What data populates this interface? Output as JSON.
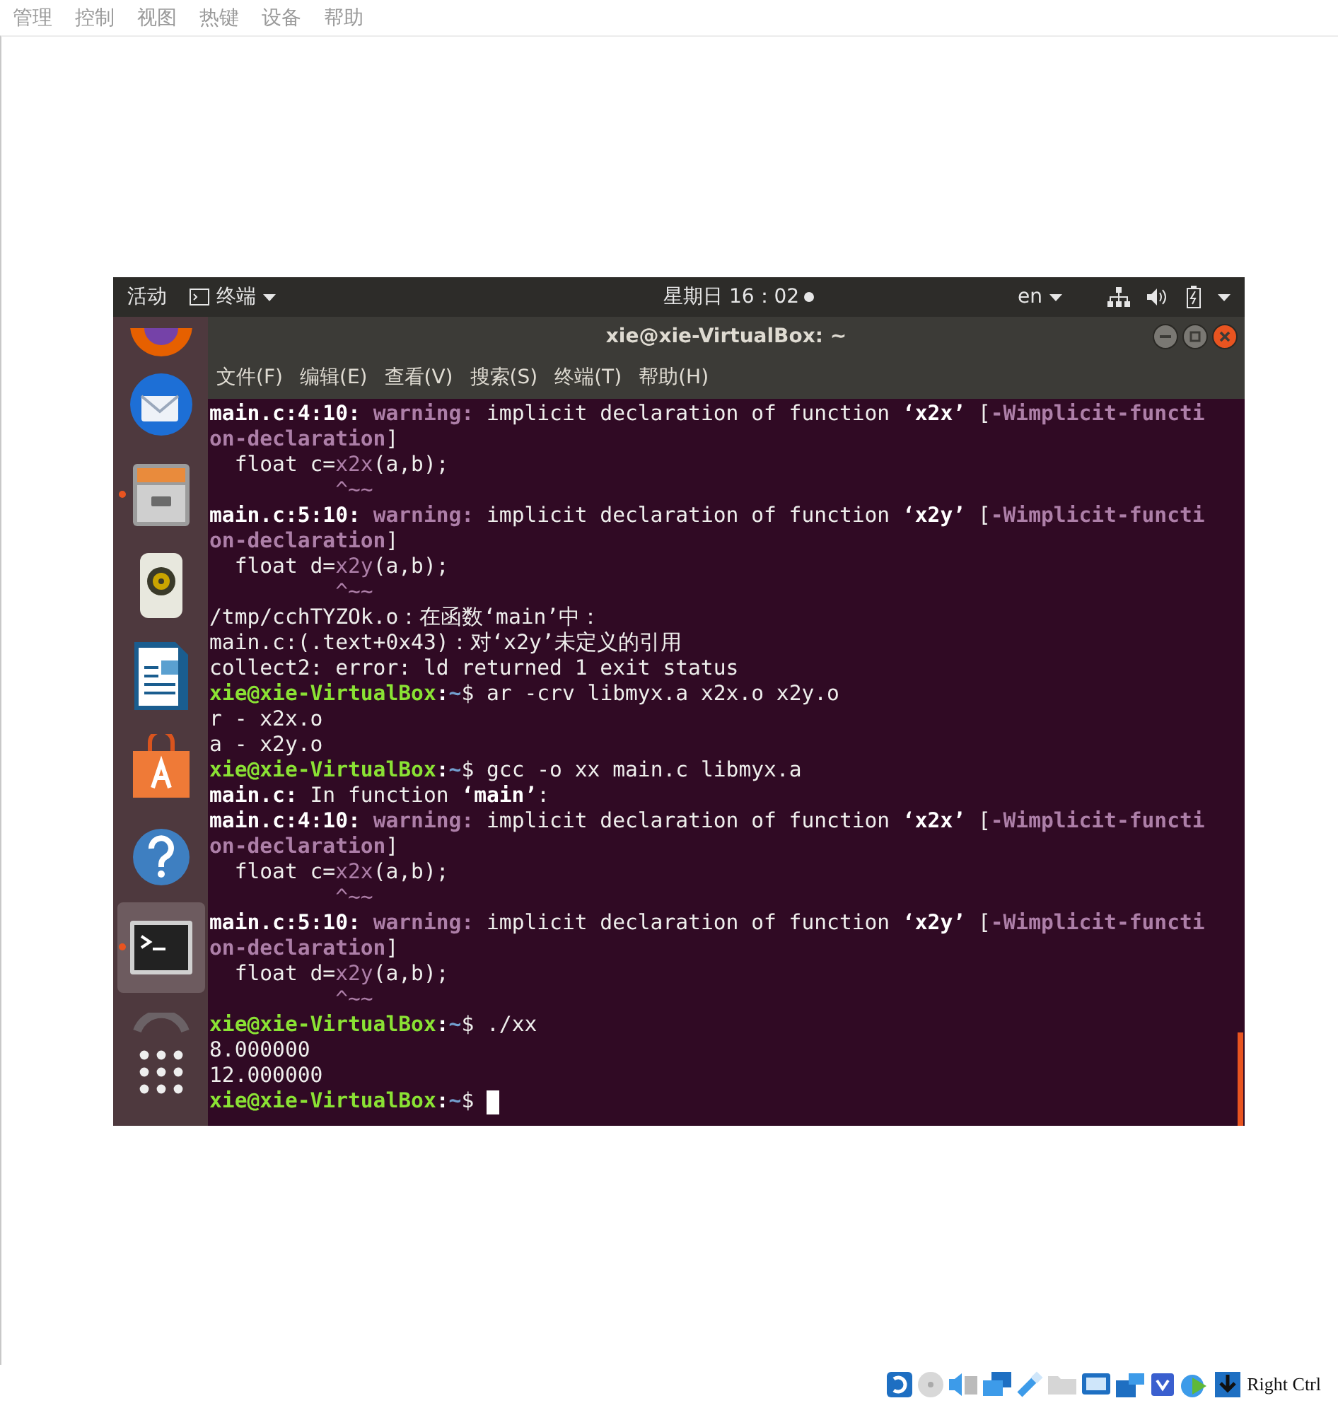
{
  "host_menu": [
    "管理",
    "控制",
    "视图",
    "热键",
    "设备",
    "帮助"
  ],
  "top_bar": {
    "activities": "活动",
    "app_menu": "终端",
    "clock": "星期日 16：02",
    "input_source": "en"
  },
  "dock": [
    {
      "kind": "browser",
      "running": false,
      "selected": false
    },
    {
      "kind": "mail",
      "running": false,
      "selected": false
    },
    {
      "kind": "files",
      "running": true,
      "selected": false
    },
    {
      "kind": "music",
      "running": false,
      "selected": false
    },
    {
      "kind": "document",
      "running": false,
      "selected": false
    },
    {
      "kind": "store",
      "running": false,
      "selected": false
    },
    {
      "kind": "help",
      "running": false,
      "selected": false
    },
    {
      "kind": "terminal",
      "running": true,
      "selected": true
    },
    {
      "kind": "arc",
      "running": false,
      "selected": false
    },
    {
      "kind": "grid",
      "running": false,
      "selected": false
    }
  ],
  "terminal": {
    "title": "xie@xie-VirtualBox: ~",
    "menu": [
      "文件(F)",
      "编辑(E)",
      "查看(V)",
      "搜索(S)",
      "终端(T)",
      "帮助(H)"
    ],
    "lines": [
      {
        "parts": [
          {
            "text": "main.c:4:10: ",
            "kind": "bold"
          },
          {
            "text": "warning:",
            "kind": "warn"
          },
          {
            "text": " implicit declaration of function ",
            "kind": "plain"
          },
          {
            "text": "‘x2x’",
            "kind": "bold"
          },
          {
            "text": " [",
            "kind": "plain"
          },
          {
            "text": "-Wimplicit-functi",
            "kind": "warn"
          }
        ]
      },
      {
        "parts": [
          {
            "text": "on-declaration",
            "kind": "warn"
          },
          {
            "text": "]",
            "kind": "plain"
          }
        ]
      },
      {
        "parts": [
          {
            "text": "  float c=",
            "kind": "plain"
          },
          {
            "text": "x2x",
            "kind": "hl"
          },
          {
            "text": "(a,b);",
            "kind": "plain"
          }
        ]
      },
      {
        "parts": [
          {
            "text": "          ^~~",
            "kind": "hl"
          }
        ]
      },
      {
        "parts": [
          {
            "text": "main.c:5:10: ",
            "kind": "bold"
          },
          {
            "text": "warning:",
            "kind": "warn"
          },
          {
            "text": " implicit declaration of function ",
            "kind": "plain"
          },
          {
            "text": "‘x2y’",
            "kind": "bold"
          },
          {
            "text": " [",
            "kind": "plain"
          },
          {
            "text": "-Wimplicit-functi",
            "kind": "warn"
          }
        ]
      },
      {
        "parts": [
          {
            "text": "on-declaration",
            "kind": "warn"
          },
          {
            "text": "]",
            "kind": "plain"
          }
        ]
      },
      {
        "parts": [
          {
            "text": "  float d=",
            "kind": "plain"
          },
          {
            "text": "x2y",
            "kind": "hl"
          },
          {
            "text": "(a,b);",
            "kind": "plain"
          }
        ]
      },
      {
        "parts": [
          {
            "text": "          ^~~",
            "kind": "hl"
          }
        ]
      },
      {
        "parts": [
          {
            "text": "/tmp/cchTYZOk.o：在函数‘main’中：",
            "kind": "plain"
          }
        ]
      },
      {
        "parts": [
          {
            "text": "main.c:(.text+0x43)：对‘x2y’未定义的引用",
            "kind": "plain"
          }
        ]
      },
      {
        "parts": [
          {
            "text": "collect2: error: ld returned 1 exit status",
            "kind": "plain"
          }
        ]
      },
      {
        "parts": [
          {
            "text": "xie@xie-VirtualBox",
            "kind": "prompt"
          },
          {
            "text": ":",
            "kind": "bold"
          },
          {
            "text": "~",
            "kind": "path"
          },
          {
            "text": "$ ar -crv libmyx.a x2x.o x2y.o",
            "kind": "plain"
          }
        ]
      },
      {
        "parts": [
          {
            "text": "r - x2x.o",
            "kind": "plain"
          }
        ]
      },
      {
        "parts": [
          {
            "text": "a - x2y.o",
            "kind": "plain"
          }
        ]
      },
      {
        "parts": [
          {
            "text": "xie@xie-VirtualBox",
            "kind": "prompt"
          },
          {
            "text": ":",
            "kind": "bold"
          },
          {
            "text": "~",
            "kind": "path"
          },
          {
            "text": "$ gcc -o xx main.c libmyx.a",
            "kind": "plain"
          }
        ]
      },
      {
        "parts": [
          {
            "text": "main.c:",
            "kind": "bold"
          },
          {
            "text": " In function ",
            "kind": "plain"
          },
          {
            "text": "‘main’",
            "kind": "bold"
          },
          {
            "text": ":",
            "kind": "plain"
          }
        ]
      },
      {
        "parts": [
          {
            "text": "main.c:4:10: ",
            "kind": "bold"
          },
          {
            "text": "warning:",
            "kind": "warn"
          },
          {
            "text": " implicit declaration of function ",
            "kind": "plain"
          },
          {
            "text": "‘x2x’",
            "kind": "bold"
          },
          {
            "text": " [",
            "kind": "plain"
          },
          {
            "text": "-Wimplicit-functi",
            "kind": "warn"
          }
        ]
      },
      {
        "parts": [
          {
            "text": "on-declaration",
            "kind": "warn"
          },
          {
            "text": "]",
            "kind": "plain"
          }
        ]
      },
      {
        "parts": [
          {
            "text": "  float c=",
            "kind": "plain"
          },
          {
            "text": "x2x",
            "kind": "hl"
          },
          {
            "text": "(a,b);",
            "kind": "plain"
          }
        ]
      },
      {
        "parts": [
          {
            "text": "          ^~~",
            "kind": "hl"
          }
        ]
      },
      {
        "parts": [
          {
            "text": "main.c:5:10: ",
            "kind": "bold"
          },
          {
            "text": "warning:",
            "kind": "warn"
          },
          {
            "text": " implicit declaration of function ",
            "kind": "plain"
          },
          {
            "text": "‘x2y’",
            "kind": "bold"
          },
          {
            "text": " [",
            "kind": "plain"
          },
          {
            "text": "-Wimplicit-functi",
            "kind": "warn"
          }
        ]
      },
      {
        "parts": [
          {
            "text": "on-declaration",
            "kind": "warn"
          },
          {
            "text": "]",
            "kind": "plain"
          }
        ]
      },
      {
        "parts": [
          {
            "text": "  float d=",
            "kind": "plain"
          },
          {
            "text": "x2y",
            "kind": "hl"
          },
          {
            "text": "(a,b);",
            "kind": "plain"
          }
        ]
      },
      {
        "parts": [
          {
            "text": "          ^~~",
            "kind": "hl"
          }
        ]
      },
      {
        "parts": [
          {
            "text": "xie@xie-VirtualBox",
            "kind": "prompt"
          },
          {
            "text": ":",
            "kind": "bold"
          },
          {
            "text": "~",
            "kind": "path"
          },
          {
            "text": "$ ./xx",
            "kind": "plain"
          }
        ]
      },
      {
        "parts": [
          {
            "text": "8.000000",
            "kind": "plain"
          }
        ]
      },
      {
        "parts": [
          {
            "text": "12.000000",
            "kind": "plain"
          }
        ]
      },
      {
        "parts": [
          {
            "text": "xie@xie-VirtualBox",
            "kind": "prompt"
          },
          {
            "text": ":",
            "kind": "bold"
          },
          {
            "text": "~",
            "kind": "path"
          },
          {
            "text": "$ ",
            "kind": "plain"
          }
        ]
      }
    ],
    "cursor": true
  },
  "status_bar": {
    "host_key": "Right Ctrl"
  }
}
